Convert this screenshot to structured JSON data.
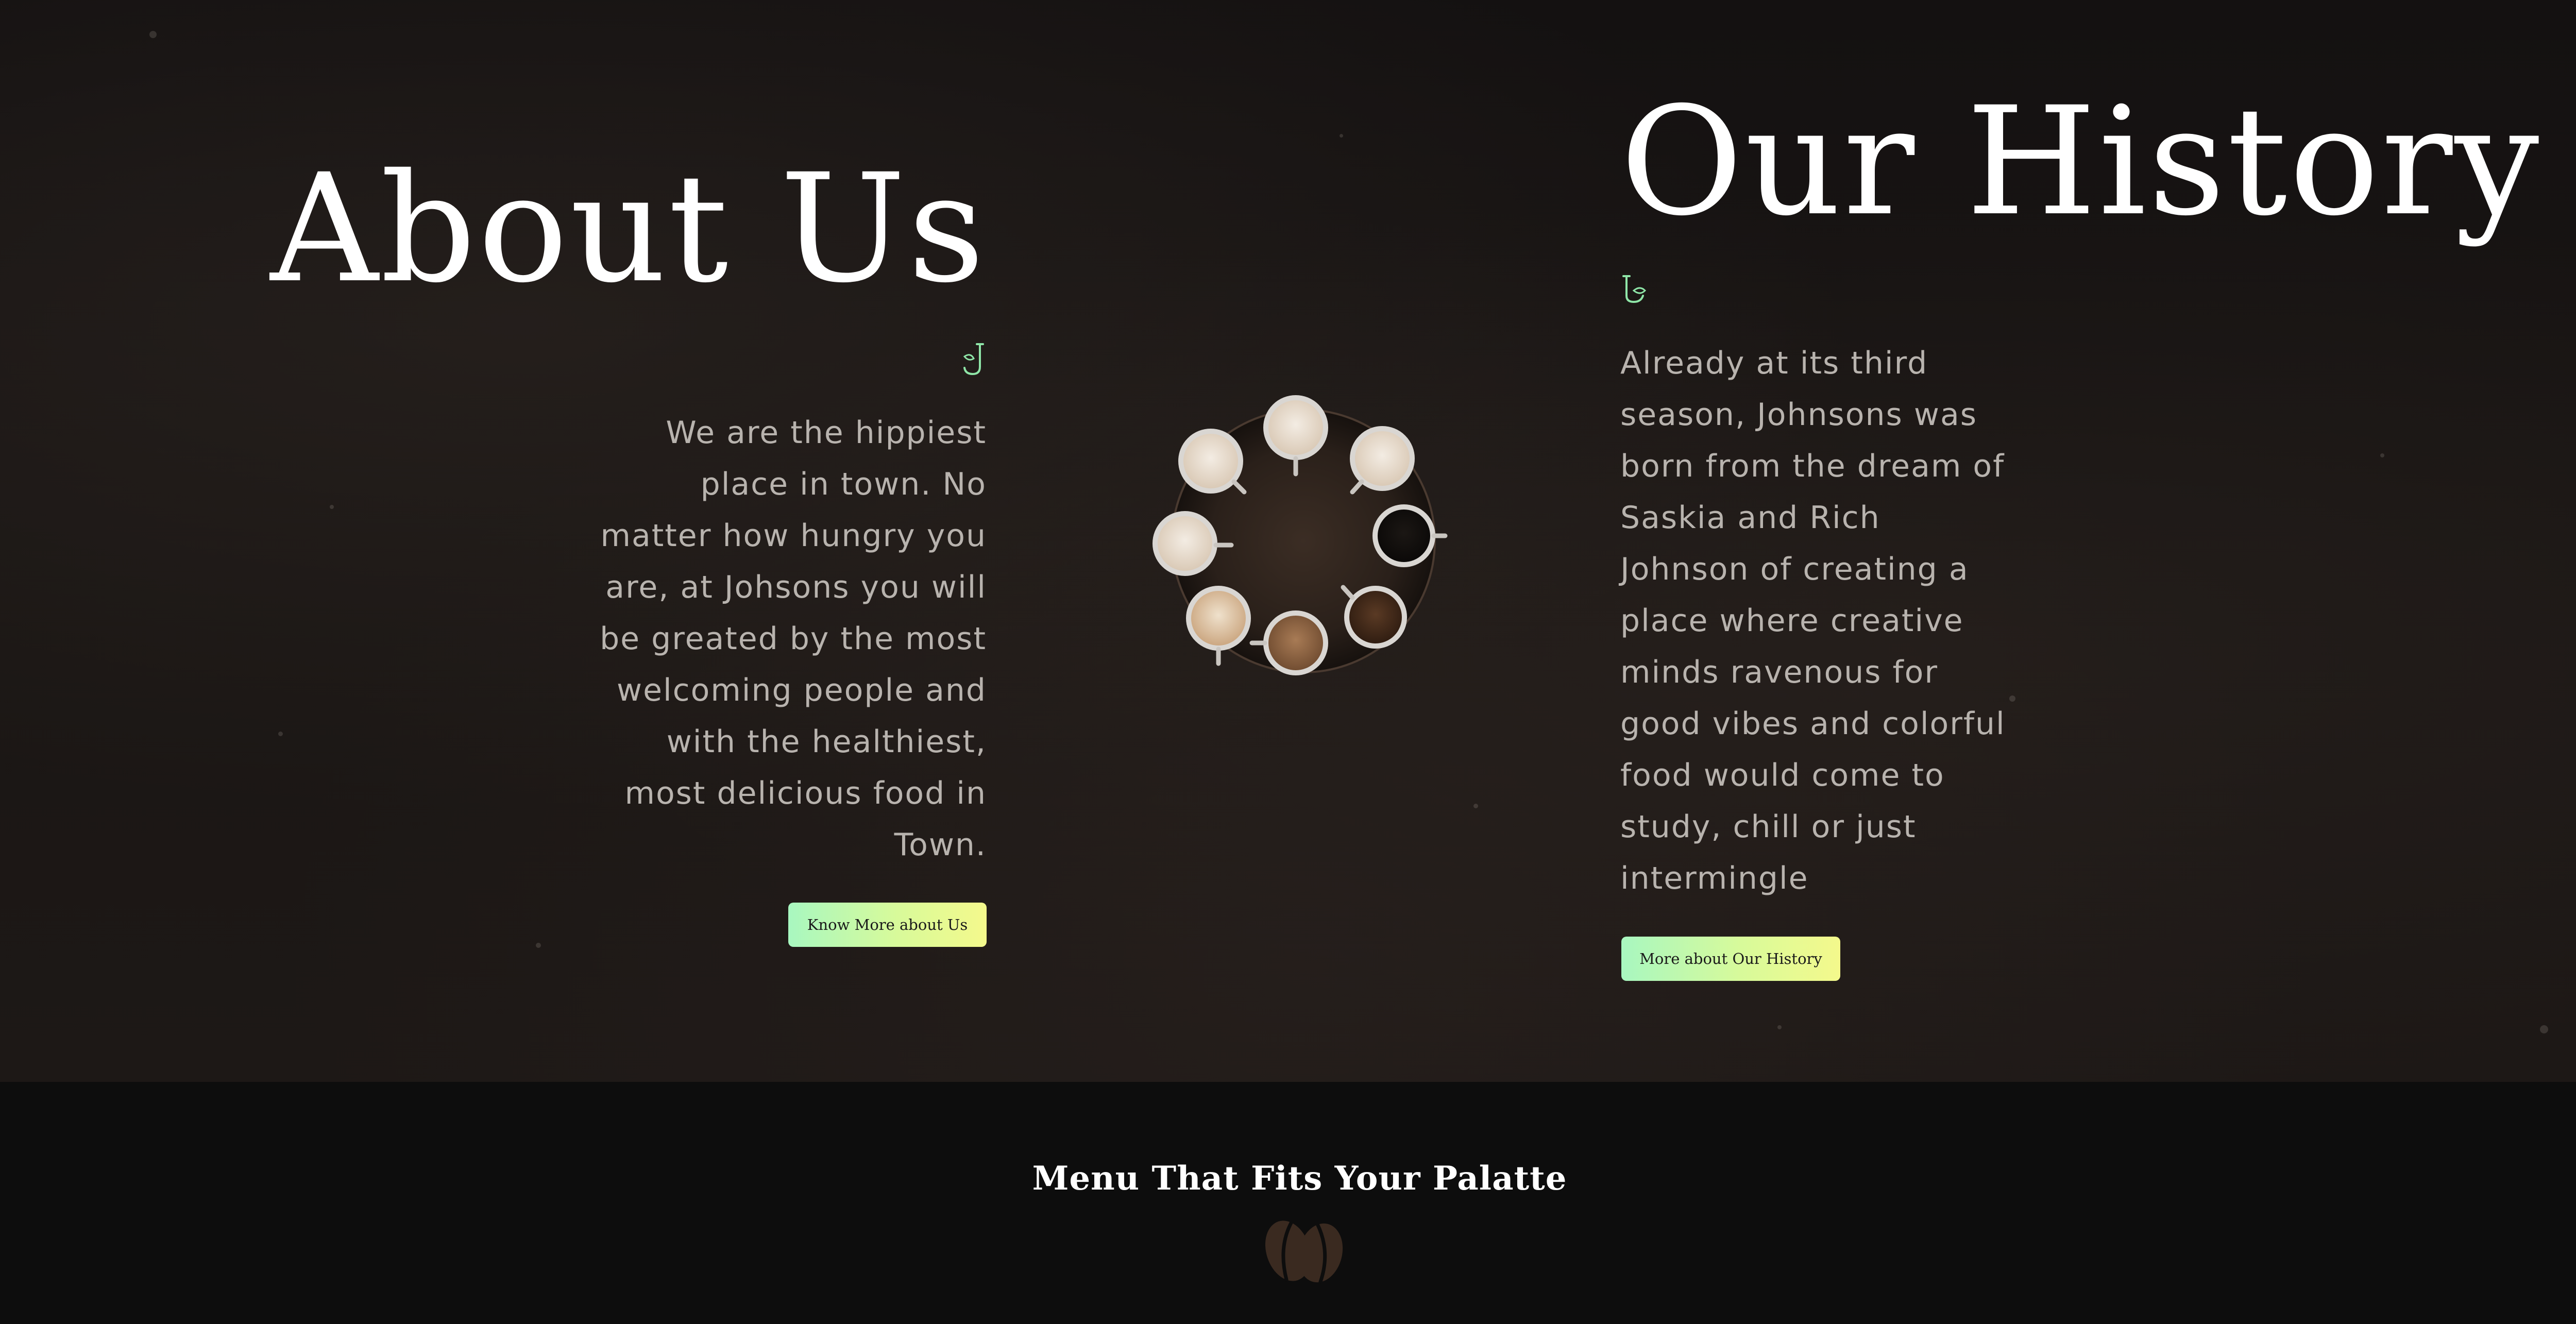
{
  "about": {
    "title": "About Us",
    "text": "We are the hippiest place in town. No matter how hungry you are, at Johsons you will be greated by the most welcoming people and with the healthiest, most delicious food in Town.",
    "button_label": "Know More about Us"
  },
  "history": {
    "title": "Our History",
    "text": "Already at its third season, Johnsons was born from the dream of Saskia and Rich Johnson of creating a place where creative minds ravenous for good vibes and colorful food would come to study, chill or just intermingle",
    "button_label": "More about Our History"
  },
  "menu": {
    "heading": "Menu That Fits Your Palatte"
  },
  "icons": {
    "about_mark": "monogram-j-icon",
    "history_mark": "monogram-j-icon",
    "cups_image": "coffee-cups-image",
    "beans": "coffee-beans-icon"
  },
  "colors": {
    "background": "#141111",
    "footer": "#0d0d0d",
    "heading": "#ffffff",
    "body_text": "#b8b3ae",
    "accent_green": "#a8f7c0",
    "accent_yellow": "#f4f98c",
    "bean_brown": "#3a2a20"
  }
}
